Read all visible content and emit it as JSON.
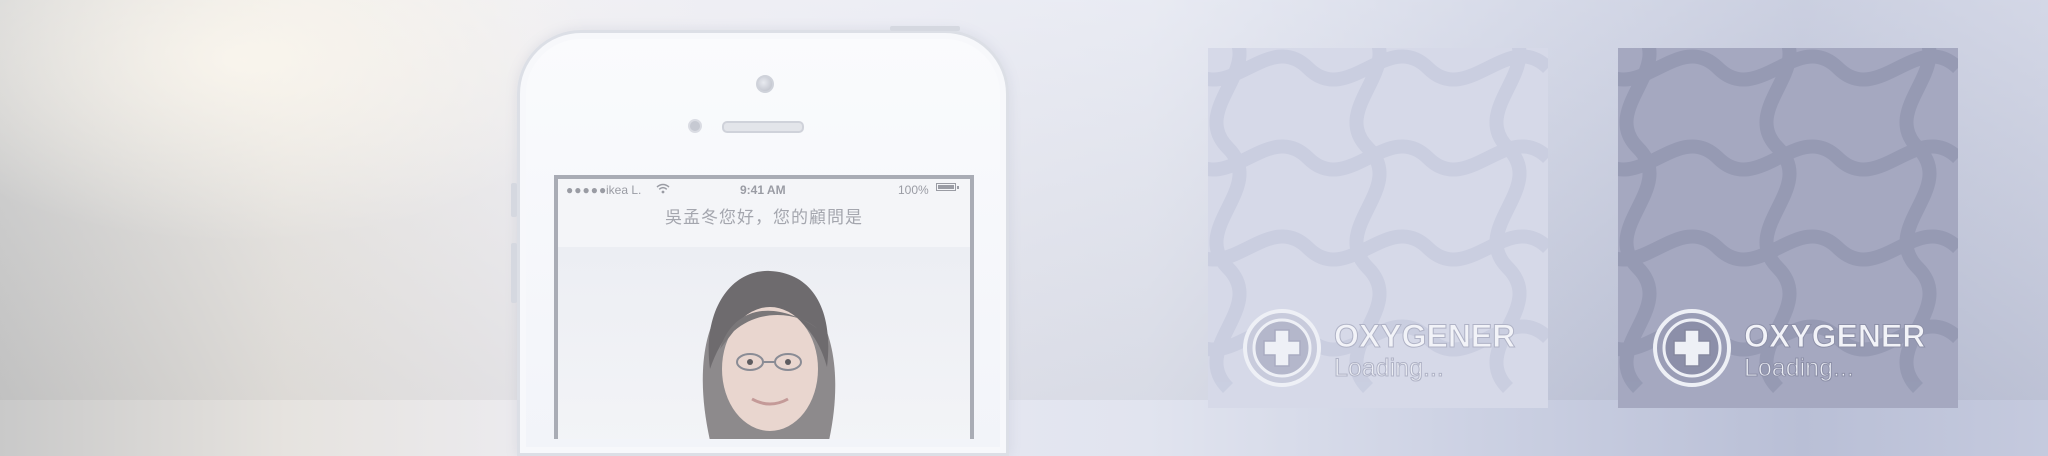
{
  "phone": {
    "status_bar": {
      "signal": "●●●●●",
      "carrier": "ikea L.",
      "wifi_icon": "wifi-icon",
      "time": "9:41 AM",
      "battery_percent": "100%"
    },
    "greeting": "吳孟冬您好，您的顧問是"
  },
  "splash_cards": [
    {
      "brand": "OXYGENER",
      "loading_text": "Loading...",
      "theme": "light",
      "bg_color": "#d6d9e8"
    },
    {
      "brand": "OXYGENER",
      "loading_text": "Loading...",
      "theme": "dark",
      "bg_color": "#a5a8c0"
    }
  ]
}
